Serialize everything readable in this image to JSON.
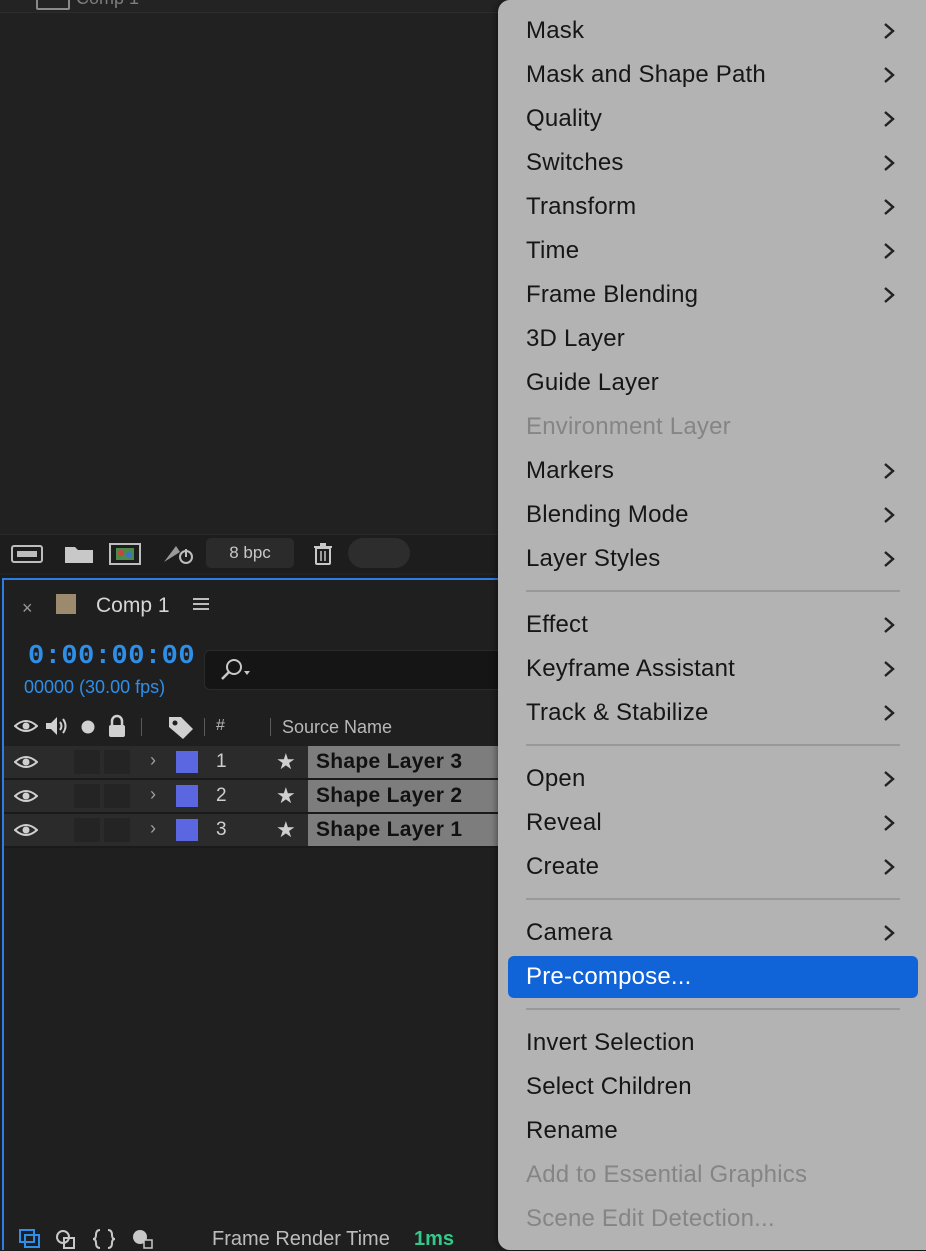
{
  "project": {
    "top_tab_label": "Comp 1",
    "bpc_label": "8 bpc"
  },
  "timeline": {
    "comp_title": "Comp 1",
    "close_glyph": "×",
    "timecode": "0:00:00:00",
    "fps_label": "00000 (30.00 fps)",
    "columns": {
      "number": "#",
      "source_name": "Source Name"
    },
    "layers": [
      {
        "number": "1",
        "name": "Shape Layer 3",
        "color": "#5b67e0"
      },
      {
        "number": "2",
        "name": "Shape Layer 2",
        "color": "#5b67e0"
      },
      {
        "number": "3",
        "name": "Shape Layer 1",
        "color": "#5b67e0"
      }
    ]
  },
  "status_bar": {
    "label": "Frame Render Time",
    "value": "1ms"
  },
  "context_menu": {
    "items": [
      {
        "label": "Mask",
        "submenu": true
      },
      {
        "label": "Mask and Shape Path",
        "submenu": true
      },
      {
        "label": "Quality",
        "submenu": true
      },
      {
        "label": "Switches",
        "submenu": true
      },
      {
        "label": "Transform",
        "submenu": true
      },
      {
        "label": "Time",
        "submenu": true
      },
      {
        "label": "Frame Blending",
        "submenu": true
      },
      {
        "label": "3D Layer",
        "submenu": false
      },
      {
        "label": "Guide Layer",
        "submenu": false
      },
      {
        "label": "Environment Layer",
        "submenu": false,
        "disabled": true
      },
      {
        "label": "Markers",
        "submenu": true
      },
      {
        "label": "Blending Mode",
        "submenu": true
      },
      {
        "label": "Layer Styles",
        "submenu": true
      },
      {
        "label": "Effect",
        "submenu": true
      },
      {
        "label": "Keyframe Assistant",
        "submenu": true
      },
      {
        "label": "Track & Stabilize",
        "submenu": true
      },
      {
        "label": "Open",
        "submenu": true
      },
      {
        "label": "Reveal",
        "submenu": true
      },
      {
        "label": "Create",
        "submenu": true
      },
      {
        "label": "Camera",
        "submenu": true
      },
      {
        "label": "Pre-compose...",
        "submenu": false,
        "highlighted": true
      },
      {
        "label": "Invert Selection",
        "submenu": false
      },
      {
        "label": "Select Children",
        "submenu": false
      },
      {
        "label": "Rename",
        "submenu": false
      },
      {
        "label": "Add to Essential Graphics",
        "submenu": false,
        "disabled": true
      },
      {
        "label": "Scene Edit Detection...",
        "submenu": false,
        "disabled": true
      }
    ]
  },
  "colors": {
    "accent_blue": "#2f8fe8",
    "highlight": "#1064d8",
    "render_time_green": "#34c98a",
    "layer_label": "#5b67e0",
    "comp_swatch": "#9b8a6e"
  }
}
